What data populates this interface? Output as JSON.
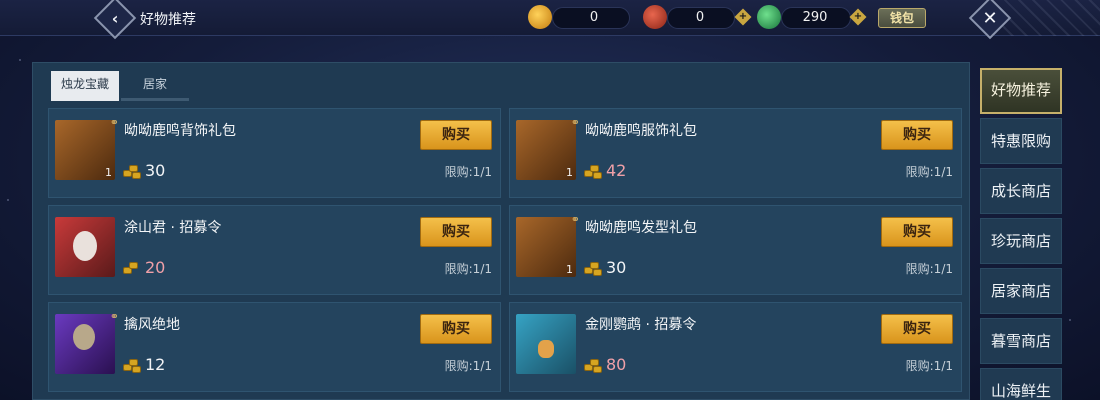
{
  "header": {
    "title": "好物推荐",
    "back_icon": "chevron-left-icon",
    "currencies": [
      {
        "icon": "gold-ingot-icon",
        "color": "#e3a21d",
        "value": "0",
        "has_plus": false
      },
      {
        "icon": "red-coin-icon",
        "color": "#c9402d",
        "value": "0",
        "has_plus": true
      },
      {
        "icon": "jade-icon",
        "color": "#2fae5a",
        "value": "290",
        "has_plus": true
      }
    ],
    "wallet_label": "钱包",
    "close_icon": "close-icon"
  },
  "tabs": [
    {
      "label": "烛龙宝藏",
      "active": true
    },
    {
      "label": "居家",
      "active": false
    }
  ],
  "items": [
    {
      "name": "呦呦鹿鸣背饰礼包",
      "qty": "1",
      "price": "30",
      "price_color": "white",
      "buy_label": "购买",
      "limit": "限购:1/1",
      "thumb_color": "#7a4a1e"
    },
    {
      "name": "呦呦鹿鸣服饰礼包",
      "qty": "1",
      "price": "42",
      "price_color": "pink",
      "buy_label": "购买",
      "limit": "限购:1/1",
      "thumb_color": "#7a4a1e"
    },
    {
      "name": "涂山君 · 招募令",
      "qty": "",
      "price": "20",
      "price_color": "pink",
      "buy_label": "购买",
      "limit": "限购:1/1",
      "thumb_color": "#b22a2e"
    },
    {
      "name": "呦呦鹿鸣发型礼包",
      "qty": "1",
      "price": "30",
      "price_color": "white",
      "buy_label": "购买",
      "limit": "限购:1/1",
      "thumb_color": "#7a4a1e"
    },
    {
      "name": "擒风绝地",
      "qty": "",
      "price": "12",
      "price_color": "white",
      "buy_label": "购买",
      "limit": "限购:1/1",
      "thumb_color": "#4a2a7a"
    },
    {
      "name": "金刚鹦鹉 · 招募令",
      "qty": "",
      "price": "80",
      "price_color": "pink",
      "buy_label": "购买",
      "limit": "限购:1/1",
      "thumb_color": "#2e8aa6"
    }
  ],
  "sidenav": [
    {
      "label": "好物推荐",
      "active": true
    },
    {
      "label": "特惠限购",
      "active": false
    },
    {
      "label": "成长商店",
      "active": false
    },
    {
      "label": "珍玩商店",
      "active": false
    },
    {
      "label": "居家商店",
      "active": false
    },
    {
      "label": "暮雪商店",
      "active": false
    },
    {
      "label": "山海鲜生",
      "active": false
    }
  ]
}
